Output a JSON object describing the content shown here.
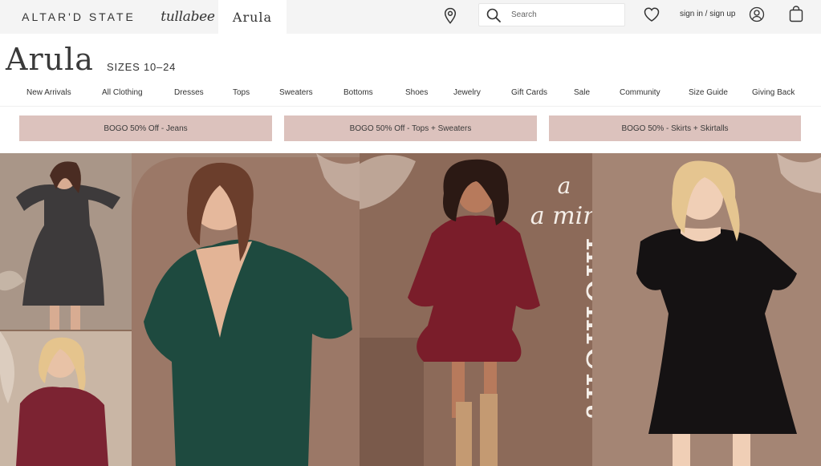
{
  "header": {
    "brands": [
      "ALTAR'D STATE",
      "tullabee",
      "Arula"
    ],
    "search_placeholder": "Search",
    "signin_label": "sign in / sign up",
    "icons": [
      "location-pin-icon",
      "search-icon",
      "heart-icon",
      "user-icon",
      "shopping-bag-icon"
    ]
  },
  "logo": {
    "name": "Arula",
    "sizes": "SIZES 10–24"
  },
  "nav": {
    "items": [
      "New Arrivals",
      "All Clothing",
      "Dresses",
      "Tops",
      "Sweaters",
      "Bottoms",
      "Shoes",
      "Jewelry",
      "Gift Cards",
      "Sale",
      "Community",
      "Size Guide",
      "Giving Back"
    ]
  },
  "promos": [
    "BOGO 50% Off - Jeans",
    "BOGO 50% Off - Tops + Sweaters",
    "BOGO 50% - Skirts + Skirtalls"
  ],
  "hero": {
    "script_text": "a mini",
    "headline": "moment"
  },
  "colors": {
    "promo_bg": "#dcc2bd",
    "topbar_bg": "#f4f4f4",
    "hero_bg": "#8c6e5c"
  }
}
